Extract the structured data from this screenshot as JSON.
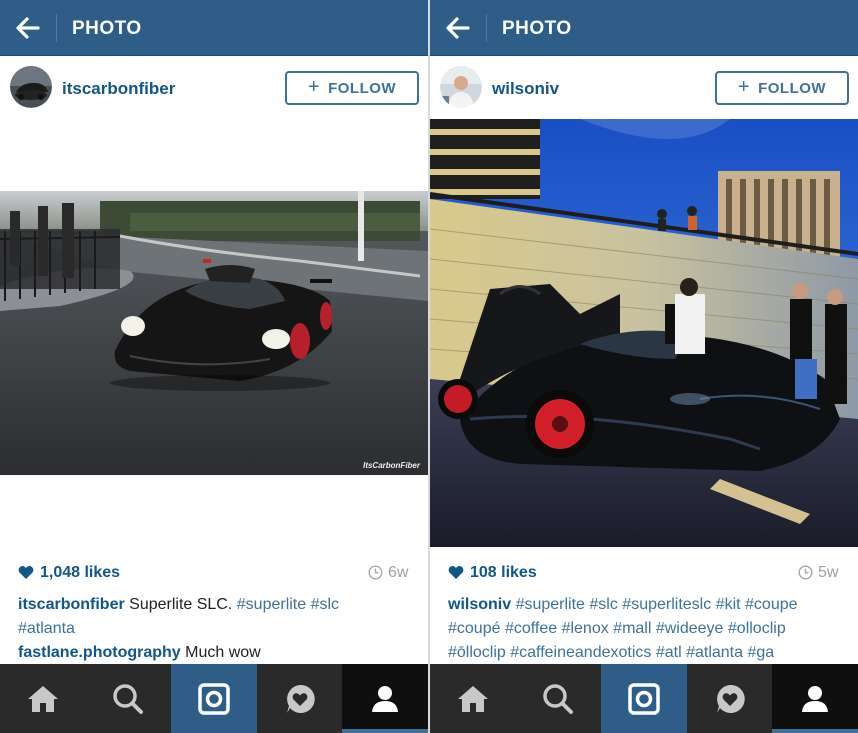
{
  "app": {
    "accent": "#2e5d87",
    "link_color": "#125688",
    "hashtag_color": "#3f729b"
  },
  "screens": [
    {
      "title": "PHOTO",
      "back_icon": "arrow-left-icon",
      "post": {
        "username": "itscarbonfiber",
        "follow_label": "FOLLOW",
        "likes": "1,048 likes",
        "time": "6w",
        "watermark": "ItsCarbonFiber",
        "caption": {
          "username": "itscarbonfiber",
          "text": "Superlite SLC.",
          "tags_line1": "#superlite #slc",
          "tags_line2": "#atlanta"
        },
        "comment": {
          "username": "fastlane.photography",
          "text": "Much wow"
        }
      }
    },
    {
      "title": "PHOTO",
      "back_icon": "arrow-left-icon",
      "post": {
        "username": "wilsoniv",
        "follow_label": "FOLLOW",
        "likes": "108 likes",
        "time": "5w",
        "caption": {
          "username": "wilsoniv",
          "line1_tags": "#superlite #slc #superliteslc #kit #coupe",
          "line2_tags": "#coupé #coffee #lenox #mall #wideeye #olloclip",
          "line3_tags": "#ōlloclip #caffeineandexotics #atl #atlanta #ga"
        }
      }
    }
  ],
  "tabs": [
    {
      "icon": "home-icon"
    },
    {
      "icon": "search-icon"
    },
    {
      "icon": "camera-icon"
    },
    {
      "icon": "activity-heart-icon"
    },
    {
      "icon": "profile-icon"
    }
  ]
}
